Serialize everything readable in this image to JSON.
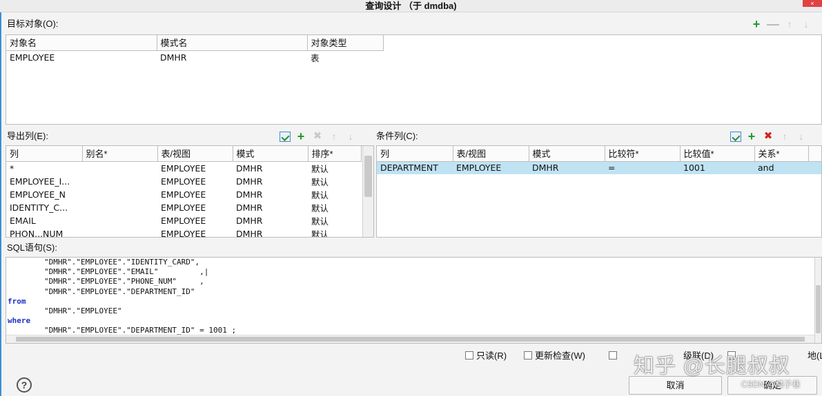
{
  "window": {
    "title": "查询设计 （于 dmdba)",
    "close_label": "×"
  },
  "target": {
    "label": "目标对象(O):",
    "columns": [
      "对象名",
      "模式名",
      "对象类型"
    ],
    "rows": [
      [
        "EMPLOYEE",
        "DMHR",
        "表"
      ]
    ]
  },
  "export": {
    "label": "导出列(E):",
    "columns": [
      "列",
      "别名*",
      "表/视图",
      "模式",
      "排序*"
    ],
    "rows": [
      [
        "*",
        "",
        "EMPLOYEE",
        "DMHR",
        "默认"
      ],
      [
        "EMPLOYEE_I...",
        "",
        "EMPLOYEE",
        "DMHR",
        "默认"
      ],
      [
        "EMPLOYEE_N",
        "",
        "EMPLOYEE",
        "DMHR",
        "默认"
      ],
      [
        "IDENTITY_C...",
        "",
        "EMPLOYEE",
        "DMHR",
        "默认"
      ],
      [
        "EMAIL",
        "",
        "EMPLOYEE",
        "DMHR",
        "默认"
      ],
      [
        "PHON...NUM",
        "",
        "EMPLOYEE",
        "DMHR",
        "默认"
      ]
    ]
  },
  "condition": {
    "label": "条件列(C):",
    "columns": [
      "列",
      "表/视图",
      "模式",
      "比较符*",
      "比较值*",
      "关系*"
    ],
    "rows": [
      [
        "DEPARTMENT",
        "EMPLOYEE",
        "DMHR",
        "=",
        "1001",
        "and"
      ]
    ]
  },
  "sql": {
    "label": "SQL语句(S):",
    "lines": [
      {
        "text": "        \"DMHR\".\"EMPLOYEE\".\"IDENTITY_CARD\",",
        "kw": false
      },
      {
        "text": "        \"DMHR\".\"EMPLOYEE\".\"EMAIL\"         ,|",
        "kw": false
      },
      {
        "text": "        \"DMHR\".\"EMPLOYEE\".\"PHONE_NUM\"     ,",
        "kw": false
      },
      {
        "text": "        \"DMHR\".\"EMPLOYEE\".\"DEPARTMENT_ID\"",
        "kw": false
      },
      {
        "text": "from",
        "kw": true
      },
      {
        "text": "        \"DMHR\".\"EMPLOYEE\"",
        "kw": false
      },
      {
        "text": "where",
        "kw": true
      },
      {
        "text": "        \"DMHR\".\"EMPLOYEE\".\"DEPARTMENT_ID\" = 1001 ;",
        "kw": false
      }
    ]
  },
  "options": {
    "readonly": "只读(R)",
    "update_check": "更新检查(W)",
    "cascade": "级联(D)",
    "local": "地(L)"
  },
  "buttons": {
    "cancel": "取消",
    "ok": "确定",
    "help": "?"
  },
  "watermark": {
    "main": "知乎 @长腿叔叔",
    "sub": "CSDN @橘子巷"
  },
  "colors": {
    "accent_green": "#1f9a2d",
    "delete_red": "#d81f1f",
    "selection": "#bfe3f3",
    "keyword_blue": "#1f31c9"
  }
}
